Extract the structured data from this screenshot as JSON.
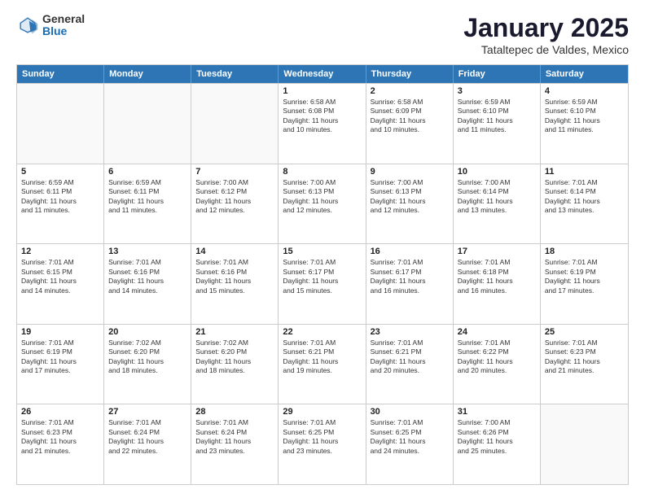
{
  "header": {
    "logo": {
      "line1": "General",
      "line2": "Blue"
    },
    "title": "January 2025",
    "subtitle": "Tataltepec de Valdes, Mexico"
  },
  "calendar": {
    "days_of_week": [
      "Sunday",
      "Monday",
      "Tuesday",
      "Wednesday",
      "Thursday",
      "Friday",
      "Saturday"
    ],
    "rows": [
      [
        {
          "day": "",
          "info": ""
        },
        {
          "day": "",
          "info": ""
        },
        {
          "day": "",
          "info": ""
        },
        {
          "day": "1",
          "info": "Sunrise: 6:58 AM\nSunset: 6:08 PM\nDaylight: 11 hours\nand 10 minutes."
        },
        {
          "day": "2",
          "info": "Sunrise: 6:58 AM\nSunset: 6:09 PM\nDaylight: 11 hours\nand 10 minutes."
        },
        {
          "day": "3",
          "info": "Sunrise: 6:59 AM\nSunset: 6:10 PM\nDaylight: 11 hours\nand 11 minutes."
        },
        {
          "day": "4",
          "info": "Sunrise: 6:59 AM\nSunset: 6:10 PM\nDaylight: 11 hours\nand 11 minutes."
        }
      ],
      [
        {
          "day": "5",
          "info": "Sunrise: 6:59 AM\nSunset: 6:11 PM\nDaylight: 11 hours\nand 11 minutes."
        },
        {
          "day": "6",
          "info": "Sunrise: 6:59 AM\nSunset: 6:11 PM\nDaylight: 11 hours\nand 11 minutes."
        },
        {
          "day": "7",
          "info": "Sunrise: 7:00 AM\nSunset: 6:12 PM\nDaylight: 11 hours\nand 12 minutes."
        },
        {
          "day": "8",
          "info": "Sunrise: 7:00 AM\nSunset: 6:13 PM\nDaylight: 11 hours\nand 12 minutes."
        },
        {
          "day": "9",
          "info": "Sunrise: 7:00 AM\nSunset: 6:13 PM\nDaylight: 11 hours\nand 12 minutes."
        },
        {
          "day": "10",
          "info": "Sunrise: 7:00 AM\nSunset: 6:14 PM\nDaylight: 11 hours\nand 13 minutes."
        },
        {
          "day": "11",
          "info": "Sunrise: 7:01 AM\nSunset: 6:14 PM\nDaylight: 11 hours\nand 13 minutes."
        }
      ],
      [
        {
          "day": "12",
          "info": "Sunrise: 7:01 AM\nSunset: 6:15 PM\nDaylight: 11 hours\nand 14 minutes."
        },
        {
          "day": "13",
          "info": "Sunrise: 7:01 AM\nSunset: 6:16 PM\nDaylight: 11 hours\nand 14 minutes."
        },
        {
          "day": "14",
          "info": "Sunrise: 7:01 AM\nSunset: 6:16 PM\nDaylight: 11 hours\nand 15 minutes."
        },
        {
          "day": "15",
          "info": "Sunrise: 7:01 AM\nSunset: 6:17 PM\nDaylight: 11 hours\nand 15 minutes."
        },
        {
          "day": "16",
          "info": "Sunrise: 7:01 AM\nSunset: 6:17 PM\nDaylight: 11 hours\nand 16 minutes."
        },
        {
          "day": "17",
          "info": "Sunrise: 7:01 AM\nSunset: 6:18 PM\nDaylight: 11 hours\nand 16 minutes."
        },
        {
          "day": "18",
          "info": "Sunrise: 7:01 AM\nSunset: 6:19 PM\nDaylight: 11 hours\nand 17 minutes."
        }
      ],
      [
        {
          "day": "19",
          "info": "Sunrise: 7:01 AM\nSunset: 6:19 PM\nDaylight: 11 hours\nand 17 minutes."
        },
        {
          "day": "20",
          "info": "Sunrise: 7:02 AM\nSunset: 6:20 PM\nDaylight: 11 hours\nand 18 minutes."
        },
        {
          "day": "21",
          "info": "Sunrise: 7:02 AM\nSunset: 6:20 PM\nDaylight: 11 hours\nand 18 minutes."
        },
        {
          "day": "22",
          "info": "Sunrise: 7:01 AM\nSunset: 6:21 PM\nDaylight: 11 hours\nand 19 minutes."
        },
        {
          "day": "23",
          "info": "Sunrise: 7:01 AM\nSunset: 6:21 PM\nDaylight: 11 hours\nand 20 minutes."
        },
        {
          "day": "24",
          "info": "Sunrise: 7:01 AM\nSunset: 6:22 PM\nDaylight: 11 hours\nand 20 minutes."
        },
        {
          "day": "25",
          "info": "Sunrise: 7:01 AM\nSunset: 6:23 PM\nDaylight: 11 hours\nand 21 minutes."
        }
      ],
      [
        {
          "day": "26",
          "info": "Sunrise: 7:01 AM\nSunset: 6:23 PM\nDaylight: 11 hours\nand 21 minutes."
        },
        {
          "day": "27",
          "info": "Sunrise: 7:01 AM\nSunset: 6:24 PM\nDaylight: 11 hours\nand 22 minutes."
        },
        {
          "day": "28",
          "info": "Sunrise: 7:01 AM\nSunset: 6:24 PM\nDaylight: 11 hours\nand 23 minutes."
        },
        {
          "day": "29",
          "info": "Sunrise: 7:01 AM\nSunset: 6:25 PM\nDaylight: 11 hours\nand 23 minutes."
        },
        {
          "day": "30",
          "info": "Sunrise: 7:01 AM\nSunset: 6:25 PM\nDaylight: 11 hours\nand 24 minutes."
        },
        {
          "day": "31",
          "info": "Sunrise: 7:00 AM\nSunset: 6:26 PM\nDaylight: 11 hours\nand 25 minutes."
        },
        {
          "day": "",
          "info": ""
        }
      ]
    ]
  }
}
